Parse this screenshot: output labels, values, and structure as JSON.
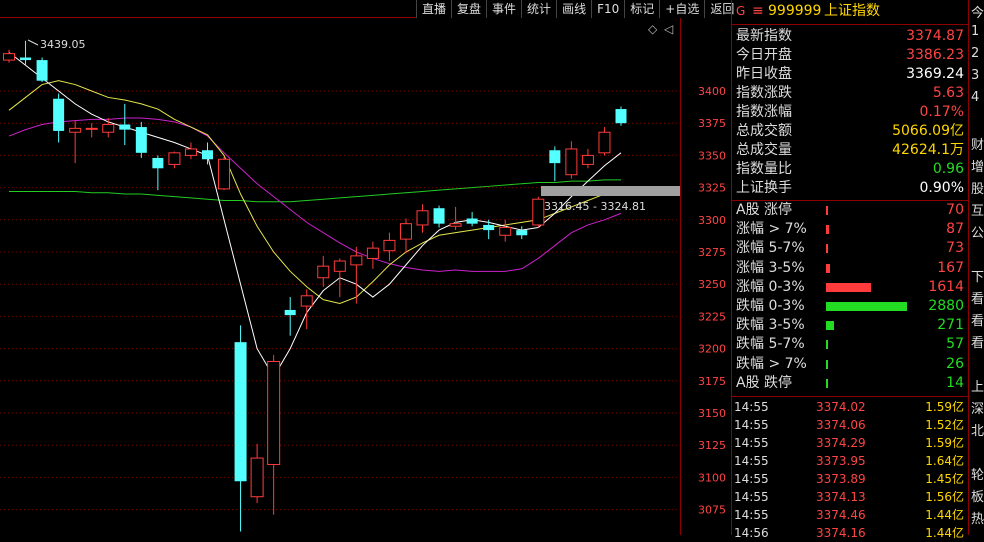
{
  "toolbar": [
    "直播",
    "复盘",
    "事件",
    "统计",
    "画线",
    "F10",
    "标记",
    "+自选",
    "返回"
  ],
  "header": {
    "g_label": "G",
    "menu_icon": "≡",
    "code": "999999",
    "name": "上证指数"
  },
  "chart_labels": {
    "high_label": "3439.05",
    "low_label": "3316.45 - 3324.81",
    "diamond": "◇",
    "arrow": "◁"
  },
  "yaxis": {
    "ticks": [
      "3400",
      "3375",
      "3350",
      "3325",
      "3300",
      "3275",
      "3250",
      "3225",
      "3200",
      "3175",
      "3150",
      "3125",
      "3100",
      "3075"
    ]
  },
  "chart_data": {
    "type": "candlestick",
    "ylim": [
      3060,
      3445
    ],
    "candles": [
      {
        "o": 3424,
        "c": 3429,
        "h": 3432,
        "l": 3422
      },
      {
        "o": 3426,
        "c": 3424,
        "h": 3439,
        "l": 3420
      },
      {
        "o": 3424,
        "c": 3408,
        "h": 3426,
        "l": 3407
      },
      {
        "o": 3394,
        "c": 3369,
        "h": 3398,
        "l": 3360
      },
      {
        "o": 3368,
        "c": 3371,
        "h": 3377,
        "l": 3344
      },
      {
        "o": 3371,
        "c": 3371,
        "h": 3375,
        "l": 3364
      },
      {
        "o": 3368,
        "c": 3374,
        "h": 3379,
        "l": 3364
      },
      {
        "o": 3374,
        "c": 3370,
        "h": 3390,
        "l": 3358
      },
      {
        "o": 3372,
        "c": 3352,
        "h": 3376,
        "l": 3348
      },
      {
        "o": 3348,
        "c": 3340,
        "h": 3350,
        "l": 3323
      },
      {
        "o": 3343,
        "c": 3352,
        "h": 3353,
        "l": 3340
      },
      {
        "o": 3350,
        "c": 3355,
        "h": 3360,
        "l": 3347
      },
      {
        "o": 3354,
        "c": 3347,
        "h": 3360,
        "l": 3343
      },
      {
        "o": 3324,
        "c": 3347,
        "h": 3349,
        "l": 3323
      },
      {
        "o": 3205,
        "c": 3097,
        "h": 3218,
        "l": 3058
      },
      {
        "o": 3085,
        "c": 3115,
        "h": 3126,
        "l": 3080
      },
      {
        "o": 3110,
        "c": 3190,
        "h": 3195,
        "l": 3071
      },
      {
        "o": 3230,
        "c": 3226,
        "h": 3240,
        "l": 3210
      },
      {
        "o": 3233,
        "c": 3241,
        "h": 3246,
        "l": 3215
      },
      {
        "o": 3255,
        "c": 3264,
        "h": 3272,
        "l": 3248
      },
      {
        "o": 3260,
        "c": 3268,
        "h": 3270,
        "l": 3240
      },
      {
        "o": 3265,
        "c": 3272,
        "h": 3279,
        "l": 3235
      },
      {
        "o": 3270,
        "c": 3278,
        "h": 3283,
        "l": 3262
      },
      {
        "o": 3276,
        "c": 3284,
        "h": 3290,
        "l": 3268
      },
      {
        "o": 3285,
        "c": 3297,
        "h": 3301,
        "l": 3274
      },
      {
        "o": 3296,
        "c": 3307,
        "h": 3312,
        "l": 3290
      },
      {
        "o": 3309,
        "c": 3297,
        "h": 3311,
        "l": 3294
      },
      {
        "o": 3295,
        "c": 3297,
        "h": 3310,
        "l": 3292
      },
      {
        "o": 3301,
        "c": 3297,
        "h": 3306,
        "l": 3295
      },
      {
        "o": 3296,
        "c": 3292,
        "h": 3300,
        "l": 3285
      },
      {
        "o": 3288,
        "c": 3294,
        "h": 3300,
        "l": 3283
      },
      {
        "o": 3292,
        "c": 3288,
        "h": 3295,
        "l": 3285
      },
      {
        "o": 3296,
        "c": 3316,
        "h": 3318,
        "l": 3294
      },
      {
        "o": 3354,
        "c": 3344,
        "h": 3357,
        "l": 3330
      },
      {
        "o": 3335,
        "c": 3355,
        "h": 3361,
        "l": 3332
      },
      {
        "o": 3343,
        "c": 3350,
        "h": 3355,
        "l": 3340
      },
      {
        "o": 3352,
        "c": 3368,
        "h": 3372,
        "l": 3350
      },
      {
        "o": 3386,
        "c": 3375,
        "h": 3388,
        "l": 3373
      }
    ],
    "ma_white": [
      3430,
      3420,
      3410,
      3400,
      3390,
      3382,
      3376,
      3372,
      3368,
      3364,
      3360,
      3355,
      3350,
      3300,
      3250,
      3200,
      3178,
      3200,
      3228,
      3245,
      3255,
      3250,
      3240,
      3250,
      3265,
      3280,
      3292,
      3298,
      3300,
      3298,
      3295,
      3292,
      3294,
      3305,
      3318,
      3330,
      3342,
      3352
    ],
    "ma_yellow": [
      3385,
      3395,
      3405,
      3408,
      3405,
      3400,
      3395,
      3393,
      3390,
      3386,
      3378,
      3372,
      3366,
      3350,
      3320,
      3295,
      3275,
      3260,
      3248,
      3238,
      3235,
      3240,
      3252,
      3265,
      3275,
      3282,
      3288,
      3290,
      3292,
      3294,
      3296,
      3298,
      3300,
      3305,
      3310,
      3315,
      3320,
      3324
    ],
    "ma_magenta": [
      3365,
      3370,
      3374,
      3376,
      3377,
      3378,
      3378,
      3379,
      3379,
      3378,
      3376,
      3372,
      3365,
      3352,
      3340,
      3328,
      3318,
      3308,
      3298,
      3290,
      3282,
      3275,
      3270,
      3266,
      3263,
      3261,
      3260,
      3261,
      3260,
      3260,
      3260,
      3262,
      3270,
      3280,
      3290,
      3296,
      3300,
      3305
    ],
    "ma_green": [
      3322,
      3322,
      3322,
      3322,
      3322,
      3321,
      3321,
      3320,
      3320,
      3319,
      3318,
      3317,
      3316,
      3315,
      3315,
      3314,
      3314,
      3314,
      3315,
      3316,
      3317,
      3318,
      3319,
      3320,
      3321,
      3322,
      3323,
      3324,
      3325,
      3326,
      3327,
      3328,
      3329,
      3329,
      3330,
      3330,
      3331,
      3331
    ]
  },
  "quote": [
    {
      "label": "最新指数",
      "value": "3374.87",
      "color": "red"
    },
    {
      "label": "今日开盘",
      "value": "3386.23",
      "color": "red"
    },
    {
      "label": "昨日收盘",
      "value": "3369.24",
      "color": "wht"
    },
    {
      "label": "指数涨跌",
      "value": "5.63",
      "color": "red"
    },
    {
      "label": "指数涨幅",
      "value": "0.17%",
      "color": "red"
    },
    {
      "label": "总成交额",
      "value": "5066.09亿",
      "color": "yel"
    },
    {
      "label": "总成交量",
      "value": "42624.1万",
      "color": "yel"
    },
    {
      "label": "指数量比",
      "value": "0.96",
      "color": "grn"
    },
    {
      "label": "上证换手",
      "value": "0.90%",
      "color": "wht"
    }
  ],
  "breadth": [
    {
      "label": "A股 涨停",
      "value": "70",
      "color": "red",
      "ratio": 0.0
    },
    {
      "label": "涨幅 > 7%",
      "value": "87",
      "color": "red",
      "ratio": 0.02
    },
    {
      "label": "涨幅 5-7%",
      "value": "73",
      "color": "red",
      "ratio": 0.0
    },
    {
      "label": "涨幅 3-5%",
      "value": "167",
      "color": "red",
      "ratio": 0.03
    },
    {
      "label": "涨幅 0-3%",
      "value": "1614",
      "color": "red",
      "ratio": 0.36
    },
    {
      "label": "跌幅 0-3%",
      "value": "2880",
      "color": "grn",
      "ratio": 0.65
    },
    {
      "label": "跌幅 3-5%",
      "value": "271",
      "color": "grn",
      "ratio": 0.06
    },
    {
      "label": "跌幅 5-7%",
      "value": "57",
      "color": "grn",
      "ratio": 0.0
    },
    {
      "label": "跌幅 > 7%",
      "value": "26",
      "color": "grn",
      "ratio": 0.0
    },
    {
      "label": "A股 跌停",
      "value": "14",
      "color": "grn",
      "ratio": 0.0
    }
  ],
  "ticks": [
    {
      "time": "14:55",
      "price": "3374.02",
      "amount": "1.59亿"
    },
    {
      "time": "14:55",
      "price": "3374.06",
      "amount": "1.52亿"
    },
    {
      "time": "14:55",
      "price": "3374.29",
      "amount": "1.59亿"
    },
    {
      "time": "14:55",
      "price": "3373.95",
      "amount": "1.64亿"
    },
    {
      "time": "14:55",
      "price": "3373.89",
      "amount": "1.45亿"
    },
    {
      "time": "14:55",
      "price": "3374.13",
      "amount": "1.56亿"
    },
    {
      "time": "14:55",
      "price": "3374.46",
      "amount": "1.44亿"
    },
    {
      "time": "14:56",
      "price": "3374.16",
      "amount": "1.44亿"
    }
  ],
  "side_chars": [
    "今",
    "1",
    "2",
    "3",
    "4",
    "",
    "财",
    "增",
    "股",
    "互",
    "公",
    "",
    "下",
    "看",
    "看",
    "看",
    "",
    "上",
    "深",
    "北",
    "",
    "轮",
    "板",
    "热"
  ]
}
